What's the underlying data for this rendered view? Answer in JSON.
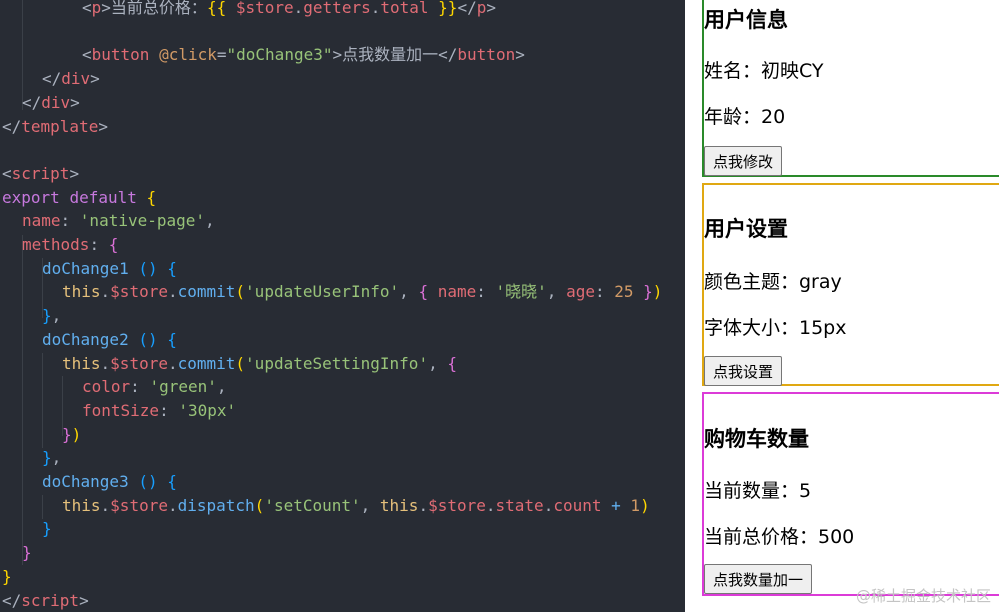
{
  "editor": {
    "lines": [
      [
        [
          "c-punc",
          "    <"
        ],
        [
          "c-tag",
          "p"
        ],
        [
          "c-punc",
          ">"
        ],
        [
          "c-text",
          "当前总价格："
        ],
        [
          "c-brace1",
          "{{ "
        ],
        [
          "c-var",
          "$store"
        ],
        [
          "c-punc",
          "."
        ],
        [
          "c-prop",
          "getters"
        ],
        [
          "c-punc",
          "."
        ],
        [
          "c-prop",
          "total"
        ],
        [
          "c-brace1",
          " }}"
        ],
        [
          "c-punc",
          "</"
        ],
        [
          "c-tag",
          "p"
        ],
        [
          "c-punc",
          ">"
        ]
      ],
      [],
      [
        [
          "c-punc",
          "    <"
        ],
        [
          "c-tag",
          "button"
        ],
        [
          "c-punc",
          " "
        ],
        [
          "c-attr",
          "@click"
        ],
        [
          "c-punc",
          "="
        ],
        [
          "c-str",
          "\"doChange3\""
        ],
        [
          "c-punc",
          ">"
        ],
        [
          "c-text",
          "点我数量加一"
        ],
        [
          "c-punc",
          "</"
        ],
        [
          "c-tag",
          "button"
        ],
        [
          "c-punc",
          ">"
        ]
      ],
      [
        [
          "c-punc",
          "  </"
        ],
        [
          "c-tag",
          "div"
        ],
        [
          "c-punc",
          ">"
        ]
      ],
      [
        [
          "c-punc",
          " </"
        ],
        [
          "c-tag",
          "div"
        ],
        [
          "c-punc",
          ">"
        ]
      ],
      [
        [
          "c-punc",
          "</"
        ],
        [
          "c-tag",
          "template"
        ],
        [
          "c-punc",
          ">"
        ]
      ],
      [],
      [
        [
          "c-punc",
          "<"
        ],
        [
          "c-tag",
          "script"
        ],
        [
          "c-punc",
          ">"
        ]
      ],
      [
        [
          "c-kw",
          "export"
        ],
        [
          "c-punc",
          " "
        ],
        [
          "c-kw",
          "default"
        ],
        [
          "c-punc",
          " "
        ],
        [
          "c-brace1",
          "{"
        ]
      ],
      [
        [
          "c-punc",
          " "
        ],
        [
          "c-prop",
          "name"
        ],
        [
          "c-punc",
          ": "
        ],
        [
          "c-str",
          "'native-page'"
        ],
        [
          "c-punc",
          ","
        ]
      ],
      [
        [
          "c-punc",
          " "
        ],
        [
          "c-prop",
          "methods"
        ],
        [
          "c-punc",
          ": "
        ],
        [
          "c-brace2",
          "{"
        ]
      ],
      [
        [
          "c-punc",
          "  "
        ],
        [
          "c-fn",
          "doChange1"
        ],
        [
          "c-punc",
          " "
        ],
        [
          "c-brace3",
          "()"
        ],
        [
          "c-punc",
          " "
        ],
        [
          "c-brace3",
          "{"
        ]
      ],
      [
        [
          "c-punc",
          "   "
        ],
        [
          "c-this",
          "this"
        ],
        [
          "c-punc",
          "."
        ],
        [
          "c-var",
          "$store"
        ],
        [
          "c-punc",
          "."
        ],
        [
          "c-fn",
          "commit"
        ],
        [
          "c-brace1",
          "("
        ],
        [
          "c-str",
          "'updateUserInfo'"
        ],
        [
          "c-punc",
          ", "
        ],
        [
          "c-brace2",
          "{"
        ],
        [
          "c-punc",
          " "
        ],
        [
          "c-prop",
          "name"
        ],
        [
          "c-punc",
          ": "
        ],
        [
          "c-str",
          "'晓晓'"
        ],
        [
          "c-punc",
          ", "
        ],
        [
          "c-prop",
          "age"
        ],
        [
          "c-punc",
          ": "
        ],
        [
          "c-num",
          "25"
        ],
        [
          "c-punc",
          " "
        ],
        [
          "c-brace2",
          "}"
        ],
        [
          "c-brace1",
          ")"
        ]
      ],
      [
        [
          "c-punc",
          "  "
        ],
        [
          "c-brace3",
          "}"
        ],
        [
          "c-punc",
          ","
        ]
      ],
      [
        [
          "c-punc",
          "  "
        ],
        [
          "c-fn",
          "doChange2"
        ],
        [
          "c-punc",
          " "
        ],
        [
          "c-brace3",
          "()"
        ],
        [
          "c-punc",
          " "
        ],
        [
          "c-brace3",
          "{"
        ]
      ],
      [
        [
          "c-punc",
          "   "
        ],
        [
          "c-this",
          "this"
        ],
        [
          "c-punc",
          "."
        ],
        [
          "c-var",
          "$store"
        ],
        [
          "c-punc",
          "."
        ],
        [
          "c-fn",
          "commit"
        ],
        [
          "c-brace1",
          "("
        ],
        [
          "c-str",
          "'updateSettingInfo'"
        ],
        [
          "c-punc",
          ", "
        ],
        [
          "c-brace2",
          "{"
        ]
      ],
      [
        [
          "c-punc",
          "    "
        ],
        [
          "c-prop",
          "color"
        ],
        [
          "c-punc",
          ": "
        ],
        [
          "c-str",
          "'green'"
        ],
        [
          "c-punc",
          ","
        ]
      ],
      [
        [
          "c-punc",
          "    "
        ],
        [
          "c-prop",
          "fontSize"
        ],
        [
          "c-punc",
          ": "
        ],
        [
          "c-str",
          "'30px'"
        ]
      ],
      [
        [
          "c-punc",
          "   "
        ],
        [
          "c-brace2",
          "}"
        ],
        [
          "c-brace1",
          ")"
        ]
      ],
      [
        [
          "c-punc",
          "  "
        ],
        [
          "c-brace3",
          "}"
        ],
        [
          "c-punc",
          ","
        ]
      ],
      [
        [
          "c-punc",
          "  "
        ],
        [
          "c-fn",
          "doChange3"
        ],
        [
          "c-punc",
          " "
        ],
        [
          "c-brace3",
          "()"
        ],
        [
          "c-punc",
          " "
        ],
        [
          "c-brace3",
          "{"
        ]
      ],
      [
        [
          "c-punc",
          "   "
        ],
        [
          "c-this",
          "this"
        ],
        [
          "c-punc",
          "."
        ],
        [
          "c-var",
          "$store"
        ],
        [
          "c-punc",
          "."
        ],
        [
          "c-fn",
          "dispatch"
        ],
        [
          "c-brace1",
          "("
        ],
        [
          "c-str",
          "'setCount'"
        ],
        [
          "c-punc",
          ", "
        ],
        [
          "c-this",
          "this"
        ],
        [
          "c-punc",
          "."
        ],
        [
          "c-var",
          "$store"
        ],
        [
          "c-punc",
          "."
        ],
        [
          "c-prop",
          "state"
        ],
        [
          "c-punc",
          "."
        ],
        [
          "c-prop",
          "count"
        ],
        [
          "c-punc",
          " "
        ],
        [
          "c-fn",
          "+"
        ],
        [
          "c-punc",
          " "
        ],
        [
          "c-num",
          "1"
        ],
        [
          "c-brace1",
          ")"
        ]
      ],
      [
        [
          "c-punc",
          "  "
        ],
        [
          "c-brace3",
          "}"
        ]
      ],
      [
        [
          "c-punc",
          " "
        ],
        [
          "c-brace2",
          "}"
        ]
      ],
      [
        [
          "c-brace1",
          "}"
        ]
      ],
      [
        [
          "c-punc",
          "</"
        ],
        [
          "c-tag",
          "script"
        ],
        [
          "c-punc",
          ">"
        ]
      ]
    ]
  },
  "preview": {
    "user": {
      "title": "用户信息",
      "name_line": "姓名：初映CY",
      "age_line": "年龄：20",
      "button": "点我修改"
    },
    "setting": {
      "title": "用户设置",
      "color_line": "颜色主题：gray",
      "font_line": "字体大小：15px",
      "button": "点我设置"
    },
    "cart": {
      "title": "购物车数量",
      "count_line": "当前数量：5",
      "price_line": "当前总价格：500",
      "button": "点我数量加一"
    },
    "watermark": "@稀土掘金技术社区"
  }
}
